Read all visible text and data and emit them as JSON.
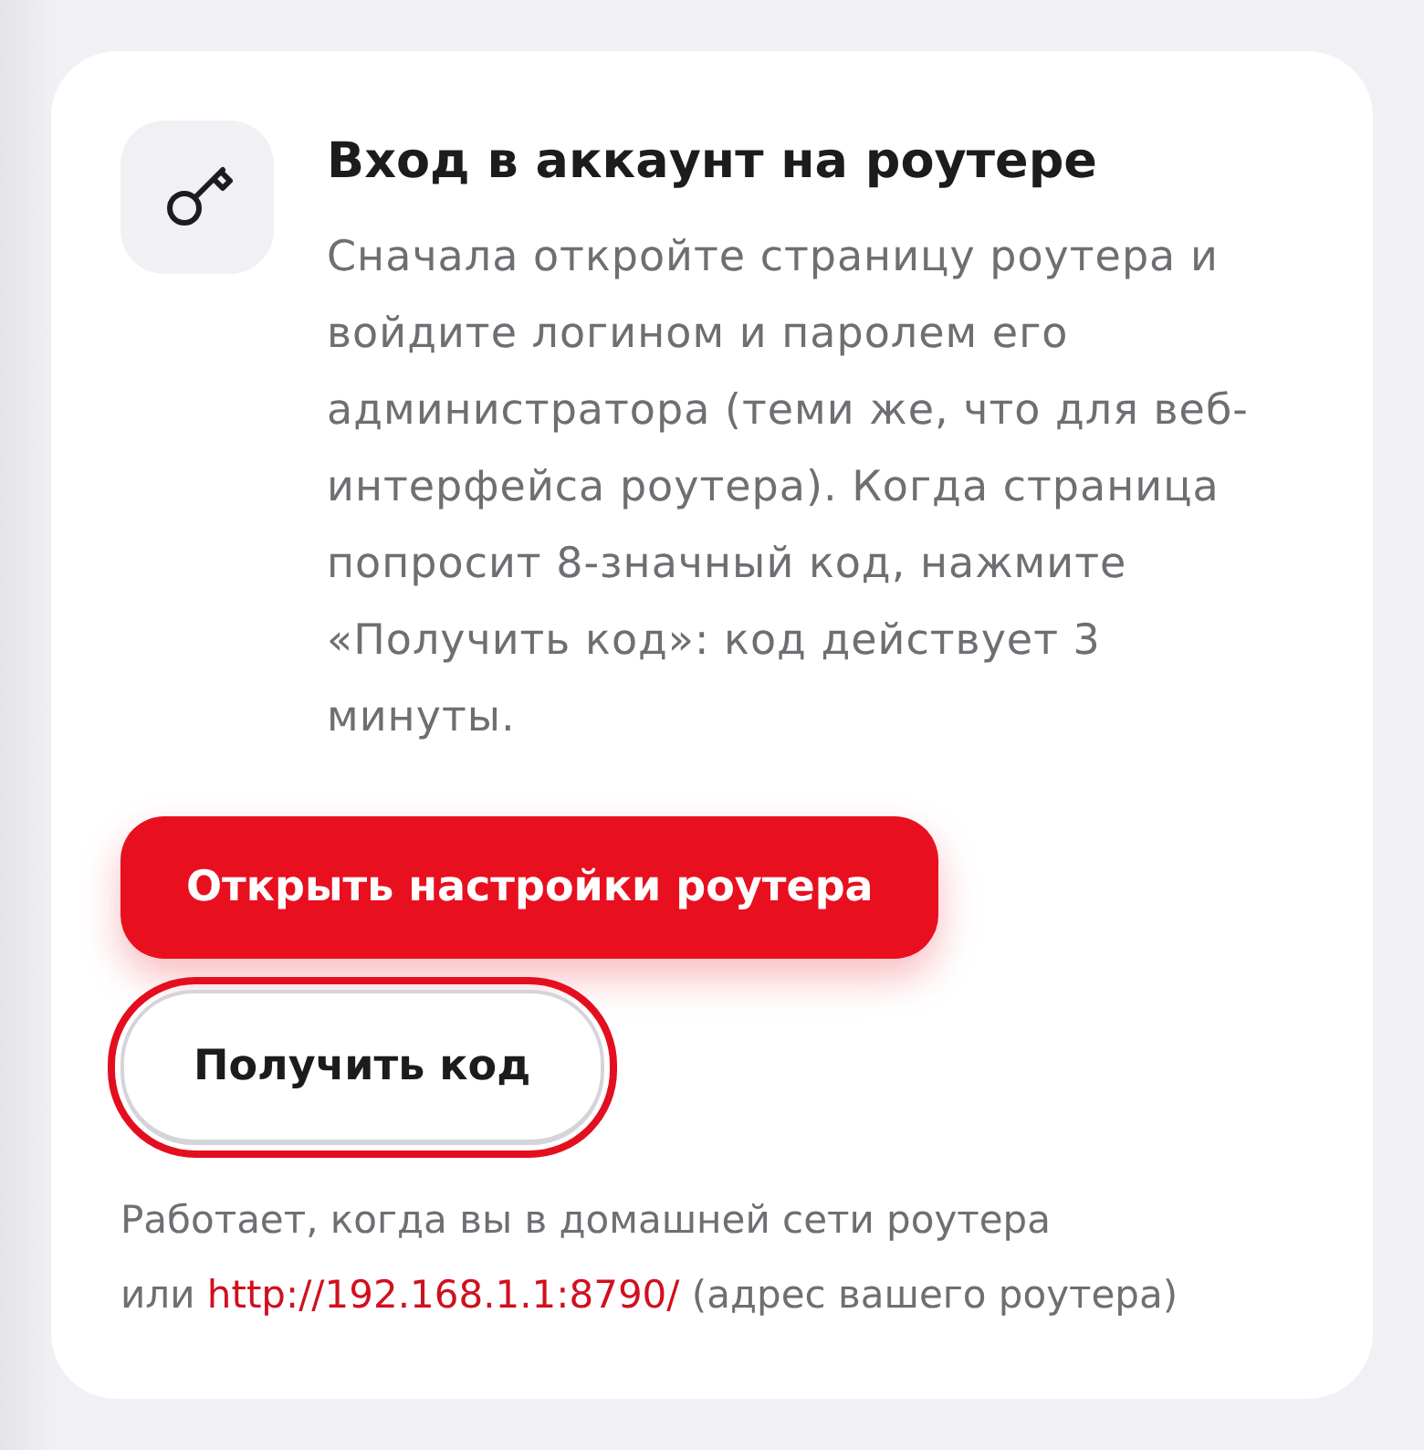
{
  "header": {
    "title": "Вход в аккаунт на роутере",
    "description": "Сначала откройте страницу роутера и войдите логином и паролем его администратора (теми же, что для веб-интерфейса роутера). Когда страница попросит 8-значный код, нажмите «Получить код»: код действует 3 минуты."
  },
  "buttons": [
    {
      "kind": "primary",
      "label": "Открыть настройки роутера",
      "focused": false
    },
    {
      "kind": "secondary",
      "label": "Получить код",
      "focused": true
    }
  ],
  "note": {
    "text": "Работает, когда вы в домашней сети роутера",
    "prefix": "или",
    "link": "http://192.168.1.1:8790/",
    "suffix": "(адрес вашего роутера)"
  }
}
